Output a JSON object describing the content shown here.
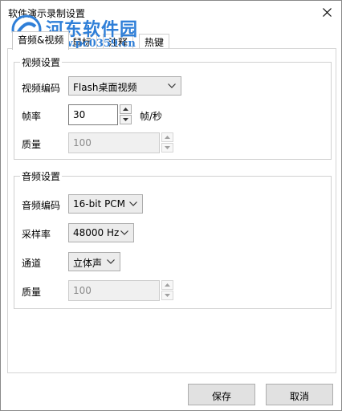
{
  "window": {
    "title": "软件演示录制设置"
  },
  "watermark": {
    "name": "河东软件园",
    "url": "www.pc0359.cn"
  },
  "tabs": [
    {
      "label": "音频&视频",
      "active": true
    },
    {
      "label": "鼠标",
      "active": false
    },
    {
      "label": "注释",
      "active": false
    },
    {
      "label": "热键",
      "active": false
    }
  ],
  "video": {
    "group_title": "视频设置",
    "codec_label": "视频编码",
    "codec_value": "Flash桌面视频",
    "fps_label": "帧率",
    "fps_value": "30",
    "fps_unit": "帧/秒",
    "quality_label": "质量",
    "quality_value": "100"
  },
  "audio": {
    "group_title": "音频设置",
    "codec_label": "音频编码",
    "codec_value": "16-bit PCM",
    "samplerate_label": "采样率",
    "samplerate_value": "48000 Hz",
    "channel_label": "通道",
    "channel_value": "立体声",
    "quality_label": "质量",
    "quality_value": "100"
  },
  "footer": {
    "save_label": "保存",
    "cancel_label": "取消"
  },
  "colors": {
    "watermark_blue": "#2f7fd8",
    "button_face": "#e1e1e1",
    "border": "#adadad"
  }
}
